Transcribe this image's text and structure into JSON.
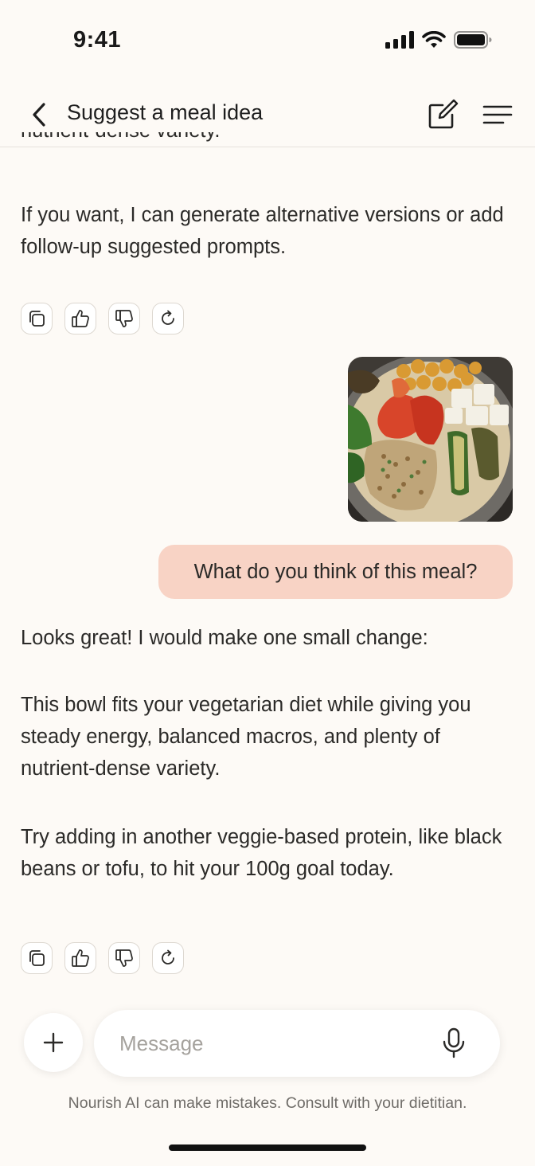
{
  "status_bar": {
    "time": "9:41"
  },
  "header": {
    "title": "Suggest a meal idea"
  },
  "chat": {
    "clipped_text": "nutrient-dense variety.",
    "message1_paragraphs": [
      "If you want, I can generate alternative versions or add follow-up suggested prompts."
    ],
    "user_message": "What do you think of this meal?",
    "reply_paragraphs": [
      "Looks great! I would make one small change:",
      "This bowl fits your vegetarian diet while giving you steady energy, balanced macros, and plenty of nutrient-dense variety.",
      "Try adding in another veggie-based protein, like black beans or tofu, to hit your 100g goal today."
    ],
    "action_icons": [
      "copy-icon",
      "thumbs-up-icon",
      "thumbs-down-icon",
      "regenerate-icon"
    ]
  },
  "composer": {
    "placeholder": "Message"
  },
  "footer": {
    "disclaimer": "Nourish AI can make mistakes. Consult with your dietitian."
  },
  "colors": {
    "background": "#FDFAF6",
    "user_bubble": "#F8D3C5"
  }
}
